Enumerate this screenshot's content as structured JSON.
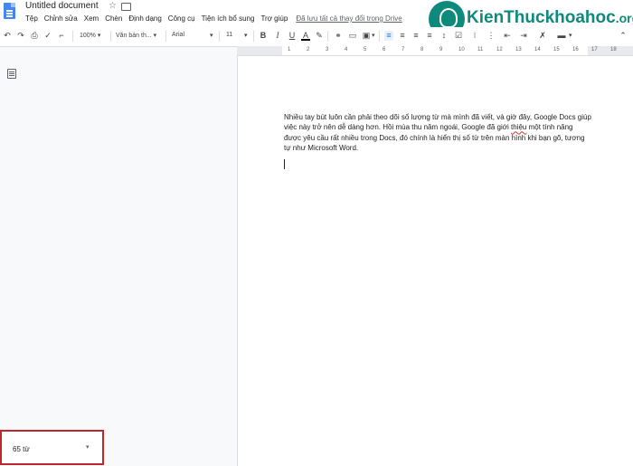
{
  "app": {
    "title": "Untitled document",
    "menu": [
      "Tệp",
      "Chỉnh sửa",
      "Xem",
      "Chèn",
      "Định dạng",
      "Công cụ",
      "Tiện ích bổ sung",
      "Trợ giúp"
    ],
    "saved_status": "Đã lưu tất cả thay đổi trong Drive"
  },
  "watermark": {
    "text_main": "KienThuc",
    "text_accent": "khoahoc",
    "text_suffix": ".org",
    "color": "#0e8a7c"
  },
  "toolbar": {
    "zoom": "100%",
    "style": "Văn bản th...",
    "font": "Arial",
    "font_size": "11",
    "bold": "B",
    "italic": "I",
    "underline": "U",
    "text_color": "A"
  },
  "ruler": {
    "marks": [
      "1",
      "2",
      "3",
      "4",
      "5",
      "6",
      "7",
      "8",
      "9",
      "10",
      "11",
      "12",
      "13",
      "14",
      "15",
      "16",
      "17",
      "18"
    ]
  },
  "document": {
    "text_before": "Nhiều tay bút luôn cần phải theo dõi số lượng từ mà mình đã viết, và giờ đây, Google Docs giúp việc này trở nên dễ dàng hơn. Hồi mùa thu năm ngoái, Google đã giới ",
    "text_misspelled": "thiệu",
    "text_after": " một tính năng được yêu cầu rất nhiều trong Docs, đó chính là hiển thị số từ trên màn hình khi bạn gõ, tương tự như Microsoft Word."
  },
  "word_count": {
    "label": "65 từ",
    "caret": "▾",
    "highlight_color": "#c0262b"
  }
}
